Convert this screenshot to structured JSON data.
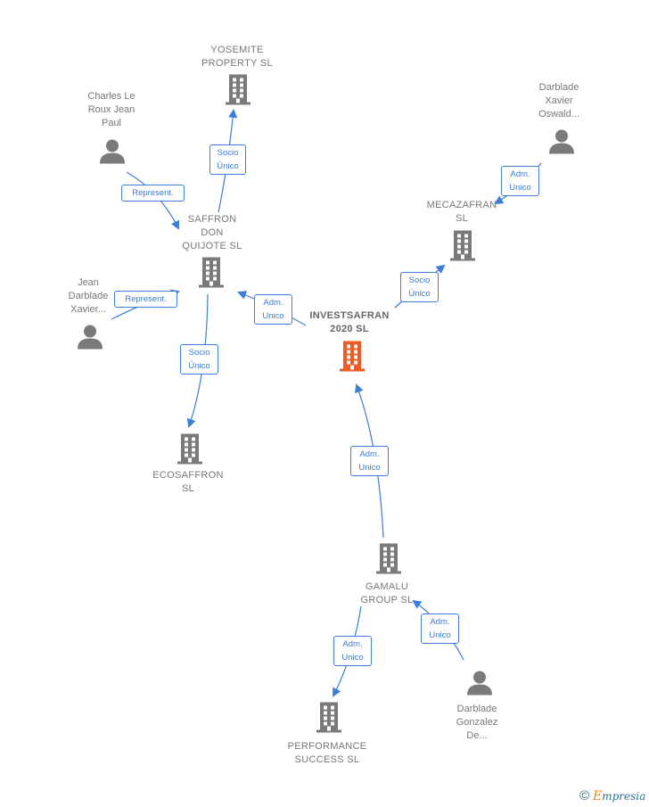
{
  "colors": {
    "company": "#7a7a7a",
    "main_company": "#f05a23",
    "person": "#7a7a7a",
    "edge": "#3b7dd8"
  },
  "nodes": [
    {
      "id": "yosemite",
      "type": "company",
      "label": "YOSEMITE\nPROPERTY  SL"
    },
    {
      "id": "charles",
      "type": "person",
      "label": "Charles Le\nRoux Jean\nPaul"
    },
    {
      "id": "saffron",
      "type": "company",
      "label": "SAFFRON\nDON\nQUIJOTE  SL"
    },
    {
      "id": "jean",
      "type": "person",
      "label": "Jean\nDarblade\nXavier..."
    },
    {
      "id": "ecosaffron",
      "type": "company",
      "label": "ECOSAFFRON\nSL"
    },
    {
      "id": "invest",
      "type": "main",
      "label": "INVESTSAFRAN\n2020  SL"
    },
    {
      "id": "darbladex",
      "type": "person",
      "label": "Darblade\nXavier\nOswald..."
    },
    {
      "id": "mecazafran",
      "type": "company",
      "label": "MECAZAFRAN\nSL"
    },
    {
      "id": "gamalu",
      "type": "company",
      "label": "GAMALU\nGROUP  SL"
    },
    {
      "id": "performance",
      "type": "company",
      "label": "PERFORMANCE\nSUCCESS  SL"
    },
    {
      "id": "darbladeg",
      "type": "person",
      "label": "Darblade\nGonzalez\nDe..."
    }
  ],
  "edges": [
    {
      "from": "saffron",
      "to": "yosemite",
      "label": "Socio\nÚnico"
    },
    {
      "from": "charles",
      "to": "saffron",
      "label": "Represent."
    },
    {
      "from": "jean",
      "to": "saffron",
      "label": "Represent."
    },
    {
      "from": "invest",
      "to": "saffron",
      "label": "Adm.\nUnico"
    },
    {
      "from": "saffron",
      "to": "ecosaffron",
      "label": "Socio\nÚnico"
    },
    {
      "from": "invest",
      "to": "mecazafran",
      "label": "Socio\nÚnico"
    },
    {
      "from": "darbladex",
      "to": "mecazafran",
      "label": "Adm.\nUnico"
    },
    {
      "from": "gamalu",
      "to": "invest",
      "label": "Adm.\nUnico"
    },
    {
      "from": "gamalu",
      "to": "performance",
      "label": "Adm.\nUnico"
    },
    {
      "from": "darbladeg",
      "to": "gamalu",
      "label": "Adm.\nUnico"
    }
  ],
  "footer": {
    "copyright_symbol": "©",
    "brand": "Empresia"
  }
}
